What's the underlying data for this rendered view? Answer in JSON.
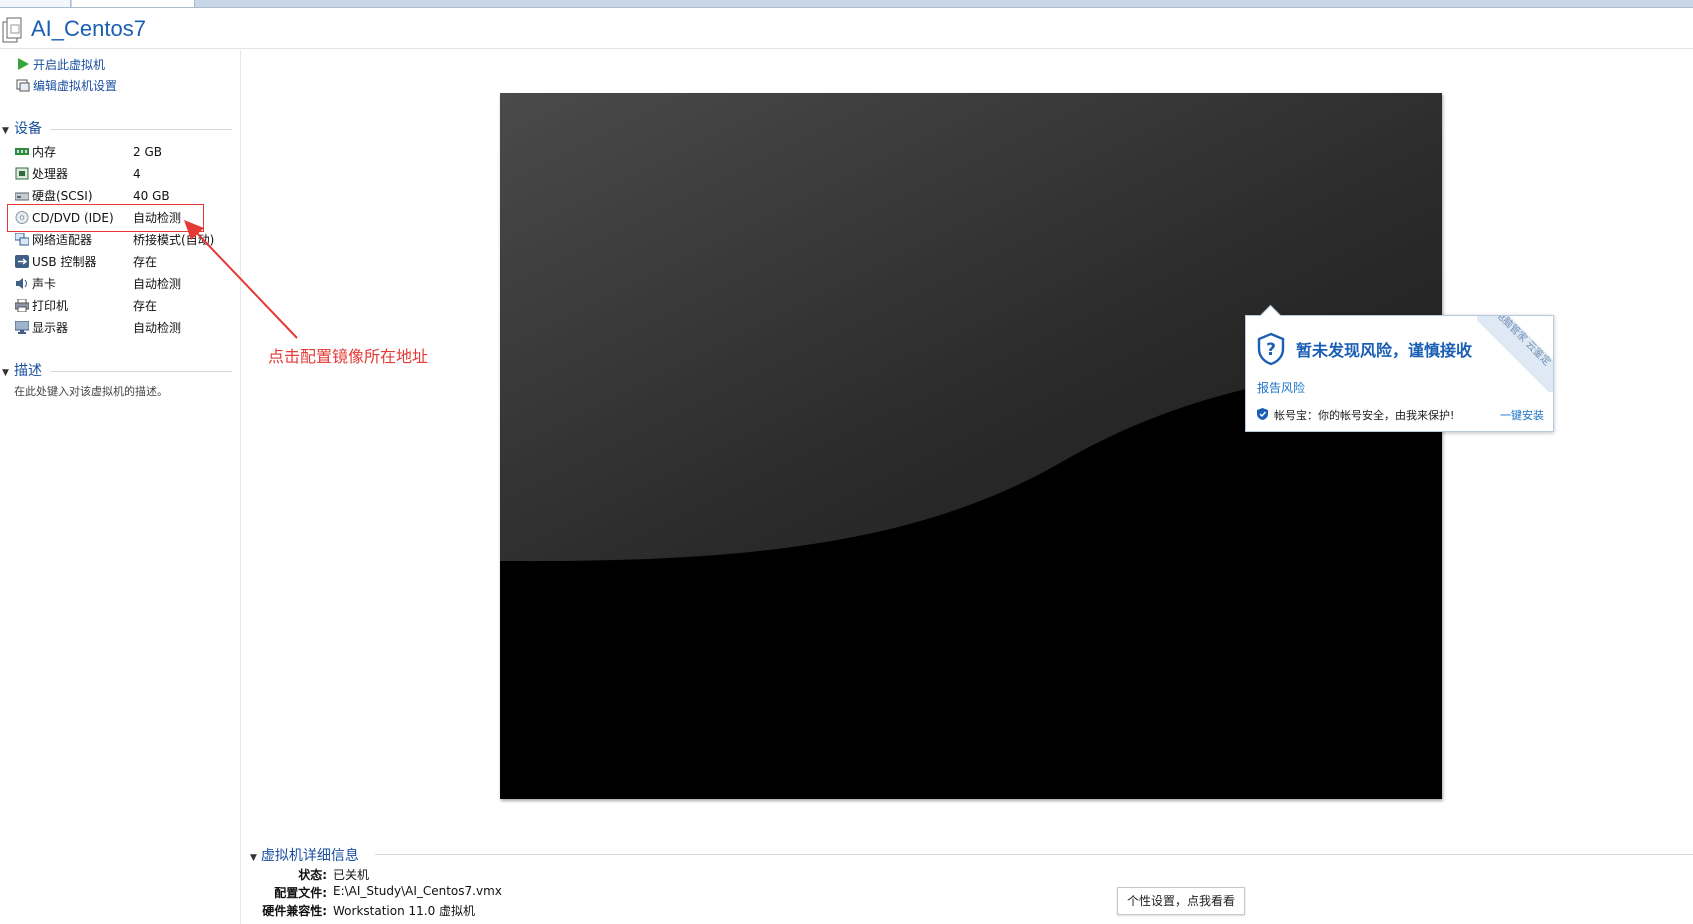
{
  "window": {
    "title": "AI_Centos7"
  },
  "actions": [
    {
      "label": "开启此虚拟机",
      "icon": "play-icon"
    },
    {
      "label": "编辑虚拟机设置",
      "icon": "settings-icon"
    }
  ],
  "devices": {
    "heading": "设备",
    "items": [
      {
        "name": "内存",
        "value": "2 GB",
        "icon": "memory-icon"
      },
      {
        "name": "处理器",
        "value": "4",
        "icon": "cpu-icon"
      },
      {
        "name": "硬盘(SCSI)",
        "value": "40 GB",
        "icon": "harddisk-icon"
      },
      {
        "name": "CD/DVD (IDE)",
        "value": "自动检测",
        "icon": "cd-icon"
      },
      {
        "name": "网络适配器",
        "value": "桥接模式(自动)",
        "icon": "network-icon"
      },
      {
        "name": "USB 控制器",
        "value": "存在",
        "icon": "usb-icon"
      },
      {
        "name": "声卡",
        "value": "自动检测",
        "icon": "sound-icon"
      },
      {
        "name": "打印机",
        "value": "存在",
        "icon": "printer-icon"
      },
      {
        "name": "显示器",
        "value": "自动检测",
        "icon": "display-icon"
      }
    ]
  },
  "annotation": {
    "text": "点击配置镜像所在地址",
    "color": "#e53935"
  },
  "description": {
    "heading": "描述",
    "placeholder": "在此处键入对该虚拟机的描述。"
  },
  "details": {
    "heading": "虚拟机详细信息",
    "rows": [
      {
        "label": "状态:",
        "value": "已关机"
      },
      {
        "label": "配置文件:",
        "value": "E:\\AI_Study\\AI_Centos7.vmx"
      },
      {
        "label": "硬件兼容性:",
        "value": "Workstation 11.0 虚拟机"
      }
    ]
  },
  "security_popup": {
    "title": "暂未发现风险，谨慎接收",
    "link": "报告风险",
    "footer_text": "帐号宝：你的帐号安全，由我来保护!",
    "footer_action": "一键安装",
    "ribbon_text": "电脑管家 云鉴定"
  },
  "tooltip": {
    "text": "个性设置，点我看看"
  },
  "colors": {
    "accent": "#1a5fb4",
    "annotation": "#e53935",
    "screen": "#000000"
  }
}
